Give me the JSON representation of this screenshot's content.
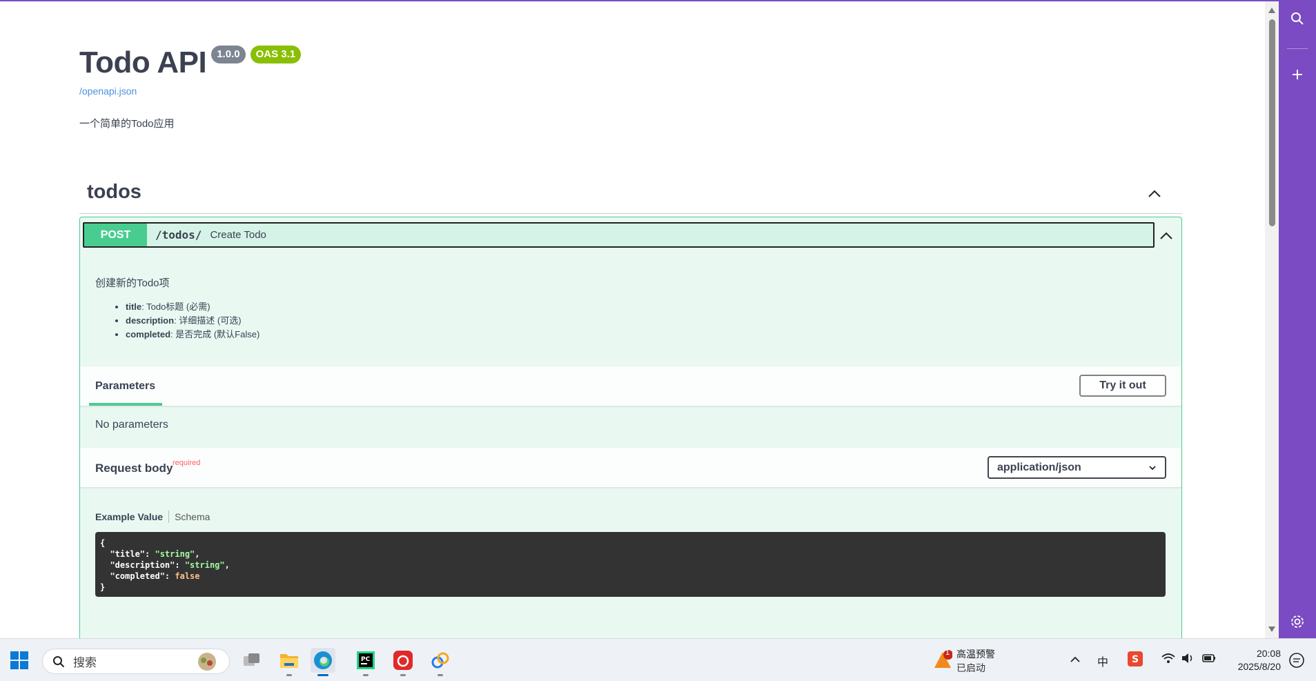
{
  "api": {
    "title": "Todo API",
    "version_badge": "1.0.0",
    "oas_badge": "OAS 3.1",
    "spec_link": "/openapi.json",
    "description": "一个简单的Todo应用"
  },
  "tag": {
    "name": "todos"
  },
  "operation": {
    "method": "POST",
    "path": "/todos/",
    "summary": "Create Todo",
    "description": "创建新的Todo项",
    "fields": [
      {
        "name": "title",
        "text": ": Todo标题 (必需)"
      },
      {
        "name": "description",
        "text": ": 详细描述 (可选)"
      },
      {
        "name": "completed",
        "text": ": 是否完成 (默认False)"
      }
    ],
    "parameters_tab": "Parameters",
    "try_it_out": "Try it out",
    "no_parameters": "No parameters",
    "request_body_label": "Request body",
    "required_label": "required",
    "content_type": "application/json",
    "example_tab": "Example Value",
    "schema_tab": "Schema",
    "example_json": {
      "open": "{",
      "line1_key": "  \"title\"",
      "line1_val": "\"string\"",
      "line2_key": "  \"description\"",
      "line2_val": "\"string\"",
      "line3_key": "  \"completed\"",
      "line3_val": "false",
      "close": "}"
    }
  },
  "taskbar": {
    "search_placeholder": "搜索",
    "weather_title": "高温预警",
    "weather_sub": "已启动",
    "weather_badge": "1",
    "ime": "中",
    "time": "20:08",
    "date": "2025/8/20"
  },
  "colors": {
    "post_green": "#49cc90",
    "rail_purple": "#7a4bc2",
    "code_bg": "#333333",
    "link_blue": "#4990e2"
  }
}
